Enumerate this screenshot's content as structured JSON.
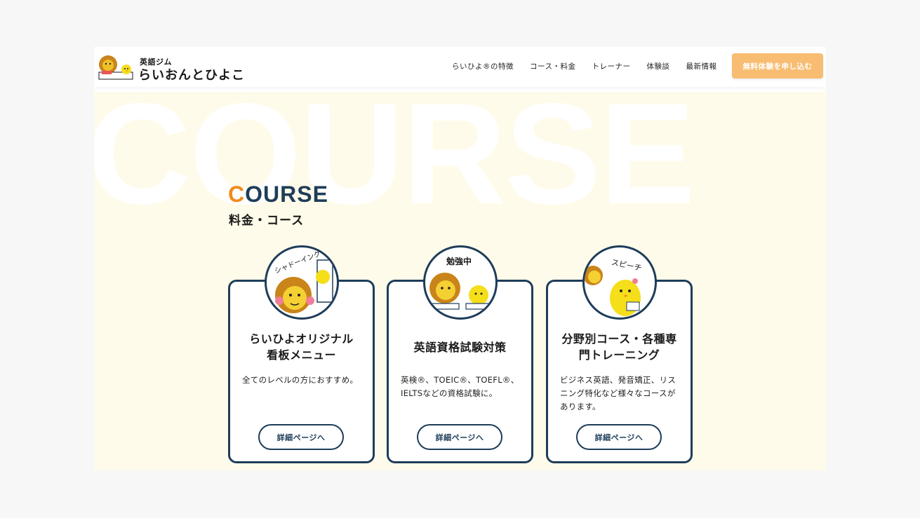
{
  "header": {
    "logo_sub": "英語ジム",
    "logo_main": "らいおんとひよこ",
    "nav": [
      {
        "label": "らいひよ®の特徴"
      },
      {
        "label": "コース・料金"
      },
      {
        "label": "トレーナー"
      },
      {
        "label": "体験談"
      },
      {
        "label": "最新情報"
      }
    ],
    "cta_label": "無料体験を申し込む"
  },
  "section": {
    "watermark": "COURSE",
    "title_first": "C",
    "title_rest": "OURSE",
    "subtitle": "料金・コース"
  },
  "cards": [
    {
      "badge": "シャドーイング",
      "title_line1": "らいひよオリジナル",
      "title_line2": "看板メニュー",
      "desc": "全てのレベルの方におすすめ。",
      "button": "詳細ページへ"
    },
    {
      "badge": "勉強中",
      "title_line1": "英語資格試験対策",
      "desc": "英検®、TOEIC®、TOEFL®、IELTSなどの資格試験に。",
      "button": "詳細ページへ"
    },
    {
      "badge": "スピーチ",
      "title_line1": "分野別コース・各種専",
      "title_line2": "門トレーニング",
      "desc": "ビジネス英語、発音矯正、リスニング特化など様々なコースがあります。",
      "button": "詳細ページへ"
    }
  ],
  "colors": {
    "navy": "#1e3d59",
    "orange": "#f28a1c",
    "cta": "#f8bd72",
    "section_bg": "#fffbea",
    "lion": "#e0a021",
    "chick": "#f5de1a"
  }
}
